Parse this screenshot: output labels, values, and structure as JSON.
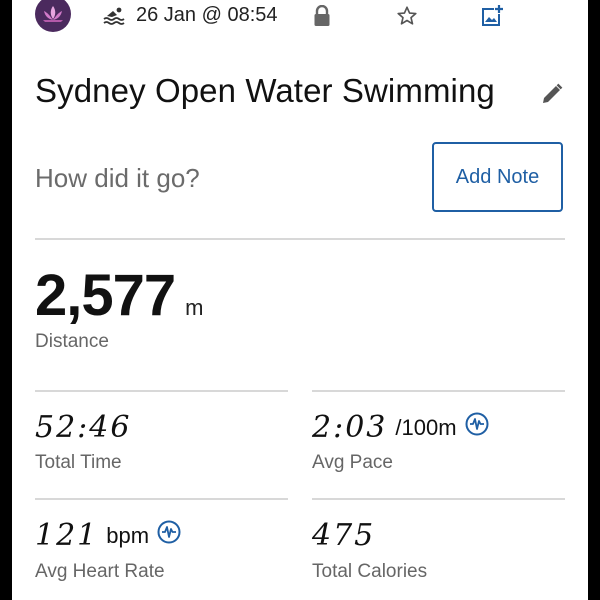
{
  "header": {
    "date_time": "26 Jan @ 08:54",
    "activity_icon": "swim-icon",
    "icons": [
      "lock-icon",
      "star-icon",
      "add-photo-icon"
    ]
  },
  "activity": {
    "title": "Sydney Open Water Swimming"
  },
  "note": {
    "prompt": "How did it go?",
    "button_label": "Add Note"
  },
  "distance": {
    "value": "2,577",
    "unit": "m",
    "label": "Distance"
  },
  "stats": {
    "total_time": {
      "value": "52:46",
      "label": "Total Time"
    },
    "avg_pace": {
      "value": "2:03",
      "unit": "/100m",
      "label": "Avg Pace"
    },
    "avg_heart_rate": {
      "value": "121",
      "unit": "bpm",
      "label": "Avg Heart Rate"
    },
    "total_calories": {
      "value": "475",
      "label": "Total Calories"
    }
  },
  "colors": {
    "accent": "#1f5fa4",
    "avatar_bg": "#4b2a5e",
    "label_gray": "#666666"
  }
}
